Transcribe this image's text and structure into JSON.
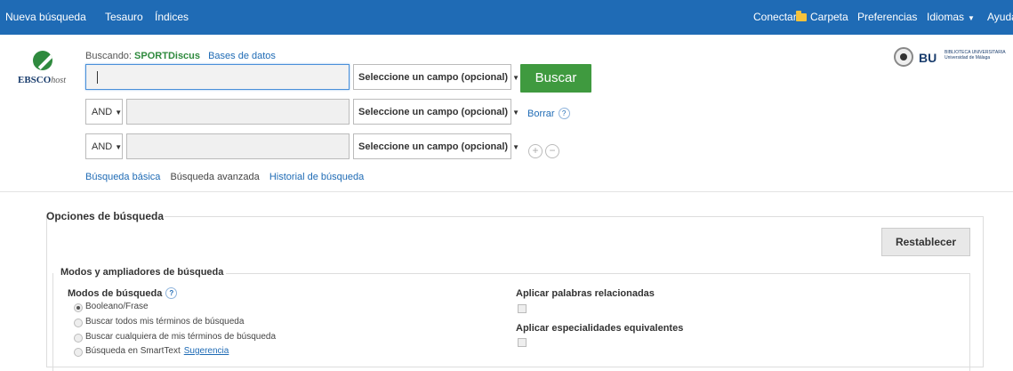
{
  "topbar": {
    "nueva": "Nueva búsqueda",
    "tesauro": "Tesauro",
    "indices": "Índices",
    "conectar": "Conectar",
    "carpeta": "Carpeta",
    "preferencias": "Preferencias",
    "idiomas": "Idiomas",
    "ayuda": "Ayuda"
  },
  "logo": {
    "brand": "EBSCO",
    "host": "host"
  },
  "searching": {
    "label": "Buscando:",
    "database": "SPORTDiscus",
    "bases_link": "Bases de datos"
  },
  "rows": [
    {
      "field": "Seleccione un campo (opcional)"
    },
    {
      "bool": "AND",
      "field": "Seleccione un campo (opcional)"
    },
    {
      "bool": "AND",
      "field": "Seleccione un campo (opcional)"
    }
  ],
  "buscar_label": "Buscar",
  "borrar_label": "Borrar",
  "subnav": {
    "basica": "Búsqueda básica",
    "avanzada": "Búsqueda avanzada",
    "historial": "Historial de búsqueda"
  },
  "library": {
    "short": "BU",
    "name_line1": "BIBLIOTECA UNIVERSITARIA",
    "name_line2": "Universidad de Málaga"
  },
  "options": {
    "title": "Opciones de búsqueda",
    "reset_label": "Restablecer",
    "modes_section_title": "Modos y ampliadores de búsqueda",
    "modes_label": "Modos de búsqueda",
    "modes": [
      {
        "label": "Booleano/Frase",
        "selected": true
      },
      {
        "label": "Buscar todos mis términos de búsqueda",
        "selected": false
      },
      {
        "label": "Buscar cualquiera de mis términos de búsqueda",
        "selected": false
      },
      {
        "label": "Búsqueda en SmartText",
        "selected": false
      }
    ],
    "sugerencia_link": "Sugerencia",
    "apply_related": "Aplicar palabras relacionadas",
    "apply_equivalent": "Aplicar especialidades equivalentes"
  }
}
